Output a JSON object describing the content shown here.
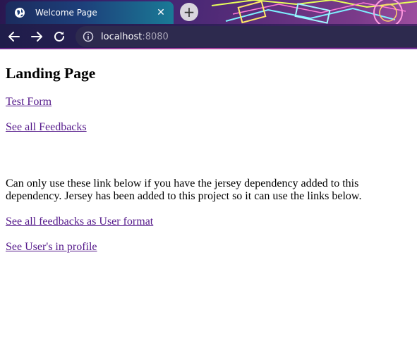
{
  "browser": {
    "tab_title": "Welcome Page",
    "tab_close_glyph": "✕",
    "new_tab_glyph": "+",
    "url_host": "localhost",
    "url_port": ":8080",
    "icons": {
      "favicon": "globe-icon",
      "close": "close-icon",
      "new_tab": "plus-icon",
      "back": "back-arrow-icon",
      "forward": "forward-arrow-icon",
      "reload": "reload-icon",
      "site_info": "info-icon"
    },
    "colors": {
      "tab_start": "#1b2c5e",
      "tab_end": "#1a7a96",
      "toolbar": "#2b1f55"
    }
  },
  "page": {
    "heading": "Landing Page",
    "links_top": [
      {
        "label": "Test Form"
      },
      {
        "label": "See all Feedbacks"
      }
    ],
    "note": "Can only use these link below if you have the jersey dependency added to this dependency. Jersey has been added to this project so it can use the links below.",
    "links_bottom": [
      {
        "label": "See all feedbacks as User format"
      },
      {
        "label": "See User's in profile"
      }
    ],
    "colors": {
      "link": "#551a8b",
      "text": "#000000"
    }
  }
}
